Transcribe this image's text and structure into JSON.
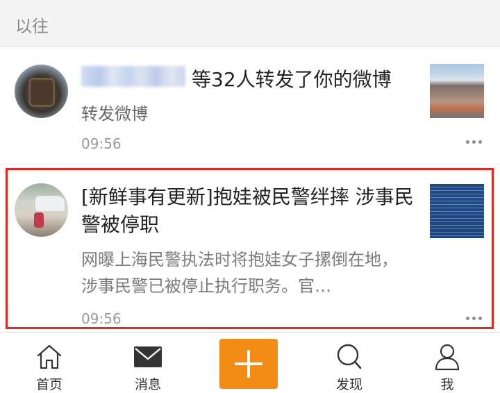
{
  "section": {
    "title": "以往"
  },
  "notifications": [
    {
      "title": "等32人转发了你的微博",
      "subtitle": "转发微博",
      "time": "09:56"
    },
    {
      "title": "[新鲜事有更新]抱娃被民警绊摔 涉事民警被停职",
      "description": "网曝上海民警执法时将抱娃女子摞倒在地，涉事民警已被停止执行职务。官…",
      "time": "09:56"
    }
  ],
  "colors": {
    "accent": "#f48b15",
    "highlight": "#e6261f"
  },
  "tabbar": {
    "items": [
      {
        "label": "首页",
        "icon": "home-icon"
      },
      {
        "label": "消息",
        "icon": "mail-icon"
      },
      {
        "label": "",
        "icon": "plus-icon"
      },
      {
        "label": "发现",
        "icon": "search-icon"
      },
      {
        "label": "我",
        "icon": "person-icon"
      }
    ]
  }
}
